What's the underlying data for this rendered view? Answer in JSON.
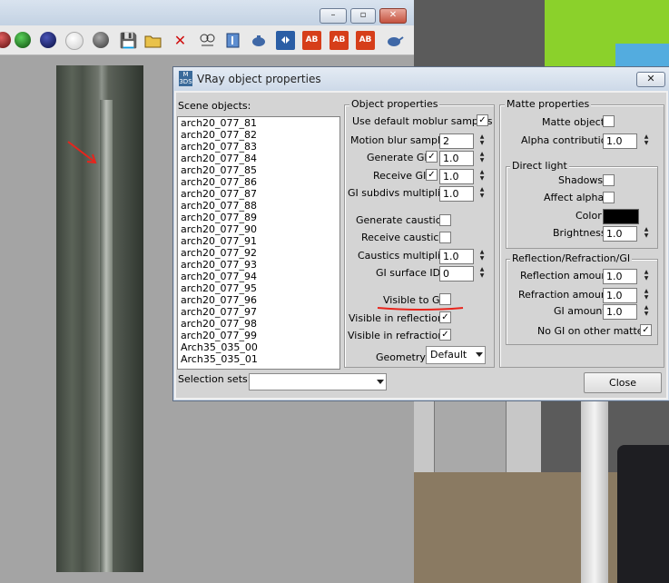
{
  "dialog": {
    "title": "VRay object properties",
    "logo_text": "M\n3DS",
    "close_icon": "x-icon",
    "scene_objects_label": "Scene objects:",
    "scene_objects": [
      "arch20_077_81",
      "arch20_077_82",
      "arch20_077_83",
      "arch20_077_84",
      "arch20_077_85",
      "arch20_077_86",
      "arch20_077_87",
      "arch20_077_88",
      "arch20_077_89",
      "arch20_077_90",
      "arch20_077_91",
      "arch20_077_92",
      "arch20_077_93",
      "arch20_077_94",
      "arch20_077_95",
      "arch20_077_96",
      "arch20_077_97",
      "arch20_077_98",
      "arch20_077_99",
      "Arch35_035_00",
      "Arch35_035_01"
    ],
    "selection_sets_label": "Selection sets:",
    "selection_sets_value": "",
    "close_button": "Close"
  },
  "object_properties": {
    "title": "Object properties",
    "use_default_moblur": {
      "label": "Use default moblur samples",
      "checked": true
    },
    "motion_blur_samples": {
      "label": "Motion blur samples",
      "value": "2"
    },
    "generate_gi": {
      "label": "Generate GI",
      "checked": true,
      "value": "1.0"
    },
    "receive_gi": {
      "label": "Receive GI",
      "checked": true,
      "value": "1.0"
    },
    "gi_subdivs_multiplier": {
      "label": "GI subdivs multiplier",
      "value": "1.0"
    },
    "generate_caustics": {
      "label": "Generate caustics",
      "checked": false
    },
    "receive_caustics": {
      "label": "Receive caustics",
      "checked": false
    },
    "caustics_multiplier": {
      "label": "Caustics multiplier",
      "value": "1.0"
    },
    "gi_surface_id": {
      "label": "GI surface ID",
      "value": "0"
    },
    "visible_to_gi": {
      "label": "Visible to GI",
      "checked": false
    },
    "visible_in_reflections": {
      "label": "Visible in reflections",
      "checked": true
    },
    "visible_in_refractions": {
      "label": "Visible in refractions",
      "checked": true
    },
    "geometry": {
      "label": "Geometry",
      "value": "Default"
    }
  },
  "matte_properties": {
    "title": "Matte properties",
    "matte_object": {
      "label": "Matte object",
      "checked": false
    },
    "alpha_contribution": {
      "label": "Alpha contribution",
      "value": "1.0"
    },
    "direct_light": {
      "title": "Direct light",
      "shadows": {
        "label": "Shadows",
        "checked": false
      },
      "affect_alpha": {
        "label": "Affect alpha",
        "checked": false
      },
      "color": {
        "label": "Color",
        "value": "#000000"
      },
      "brightness": {
        "label": "Brightness",
        "value": "1.0"
      }
    },
    "reflection_refraction_gi": {
      "title": "Reflection/Refraction/GI",
      "reflection_amount": {
        "label": "Reflection amount",
        "value": "1.0"
      },
      "refraction_amount": {
        "label": "Refraction amount",
        "value": "1.0"
      },
      "gi_amount": {
        "label": "GI amount",
        "value": "1.0"
      },
      "no_gi_on_other_mattes": {
        "label": "No GI on other mattes",
        "checked": true
      }
    }
  },
  "background_window": {
    "buttons": {
      "minimize": "–",
      "maximize": "▫",
      "close": "✕"
    },
    "toolbar_icons": [
      "sphere-red-icon",
      "sphere-green-icon",
      "sphere-blue-icon",
      "sphere-white-icon",
      "sphere-gray-icon",
      "save-icon",
      "open-folder-icon",
      "delete-icon",
      "pick-material-icon",
      "put-to-scene-icon",
      "teapot-icon",
      "video-icon",
      "ab-icon",
      "ab2-icon",
      "ab3-icon",
      "teapot2-icon"
    ],
    "toolbar_glyphs": {
      "save": "💾",
      "delete": "✕",
      "ab": "AB"
    }
  },
  "colors": {
    "annotation_red": "#e8241c",
    "green_wall": "#8bd12b"
  }
}
